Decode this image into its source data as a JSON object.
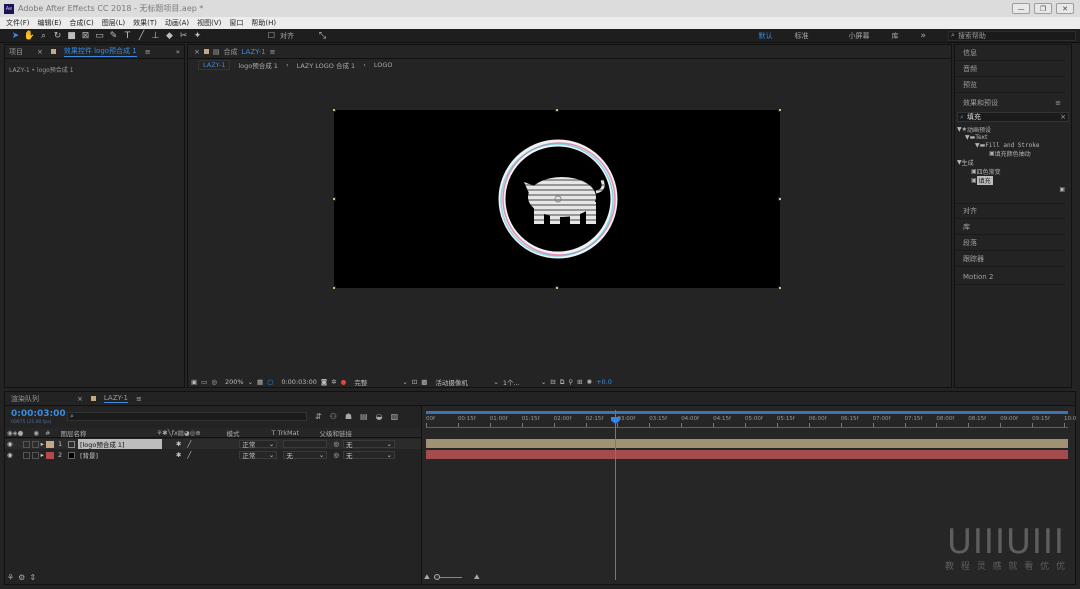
{
  "window": {
    "title": "Adobe After Effects CC 2018 - 无标题项目.aep *",
    "controls": [
      "—",
      "❐",
      "✕"
    ]
  },
  "menu": [
    "文件(F)",
    "编辑(E)",
    "合成(C)",
    "图层(L)",
    "效果(T)",
    "动画(A)",
    "视图(V)",
    "窗口",
    "帮助(H)"
  ],
  "toolbar": {
    "snap_label": "对齐",
    "workspaces": [
      "默认",
      "标准",
      "小屏幕",
      "库"
    ],
    "search_placeholder": "搜索帮助",
    "menu_icon": "≡",
    "more_icon": "»"
  },
  "left_panel": {
    "tab_project": "项目",
    "tab_effects": "效果控件 logo预合成 1",
    "breadcrumb": "LAZY-1 • logo预合成 1"
  },
  "comp_panel": {
    "tab_label": "合成",
    "tab_comp": "LAZY-1",
    "crumbs": [
      "LAZY-1",
      "logo预合成 1",
      "LAZY LOGO 合成 1",
      "LOGO"
    ],
    "footer": {
      "zoom": "200%",
      "timecode": "0:00:03:00",
      "quality": "完整",
      "camera": "活动摄像机",
      "views": "1个...",
      "exposure": "+0.0"
    }
  },
  "right_panel": {
    "items": [
      "信息",
      "音频",
      "预览",
      "效果和预设",
      "对齐",
      "库",
      "段落",
      "跟踪器",
      "Motion 2"
    ],
    "search_value": "填充",
    "tree": [
      {
        "label": "动画预设",
        "level": 0,
        "arrow": "▼"
      },
      {
        "label": "Text",
        "level": 1,
        "arrow": "▼"
      },
      {
        "label": "Fill and Stroke",
        "level": 2,
        "arrow": "▼"
      },
      {
        "label": "填充颜色抽动",
        "level": 3,
        "arrow": ""
      },
      {
        "label": "生成",
        "level": 0,
        "arrow": "▼"
      },
      {
        "label": "四色渐变",
        "level": 1,
        "arrow": ""
      },
      {
        "label": "填充",
        "level": 1,
        "arrow": "",
        "selected": true
      }
    ]
  },
  "timeline": {
    "tab_render": "渲染队列",
    "tab_comp": "LAZY-1",
    "timecode": "0:00:03:00",
    "fps": "00075 (25.00 fps)",
    "headers": {
      "name": "图层名称",
      "mode": "模式",
      "trkmat": "T  TrkMat",
      "parent": "父级和链接"
    },
    "layers": [
      {
        "num": "1",
        "name": "[logo预合成 1]",
        "mode": "正常",
        "trkmat": "",
        "parent": "无",
        "color": "#c2a983",
        "bar": "#a09374"
      },
      {
        "num": "2",
        "name": "[背景]",
        "mode": "正常",
        "trkmat": "无",
        "parent": "无",
        "color": "#b34a4a",
        "bar": "#a44c4c"
      }
    ],
    "ruler": [
      "00f",
      "00:15f",
      "01:00f",
      "01:15f",
      "02:00f",
      "02:15f",
      "03:00f",
      "03:15f",
      "04:00f",
      "04:15f",
      "05:00f",
      "05:15f",
      "06:00f",
      "06:15f",
      "07:00f",
      "07:15f",
      "08:00f",
      "08:15f",
      "09:00f",
      "09:15f",
      "10:0"
    ]
  },
  "watermark": {
    "logo": "UIIIUIII",
    "tagline": "教 程 灵 感 就 看 优 优"
  },
  "colors": {
    "accent": "#3b8cdf",
    "layer1": "#c2a983",
    "layer2": "#b34a4a",
    "playhead": "#2f86ec"
  }
}
